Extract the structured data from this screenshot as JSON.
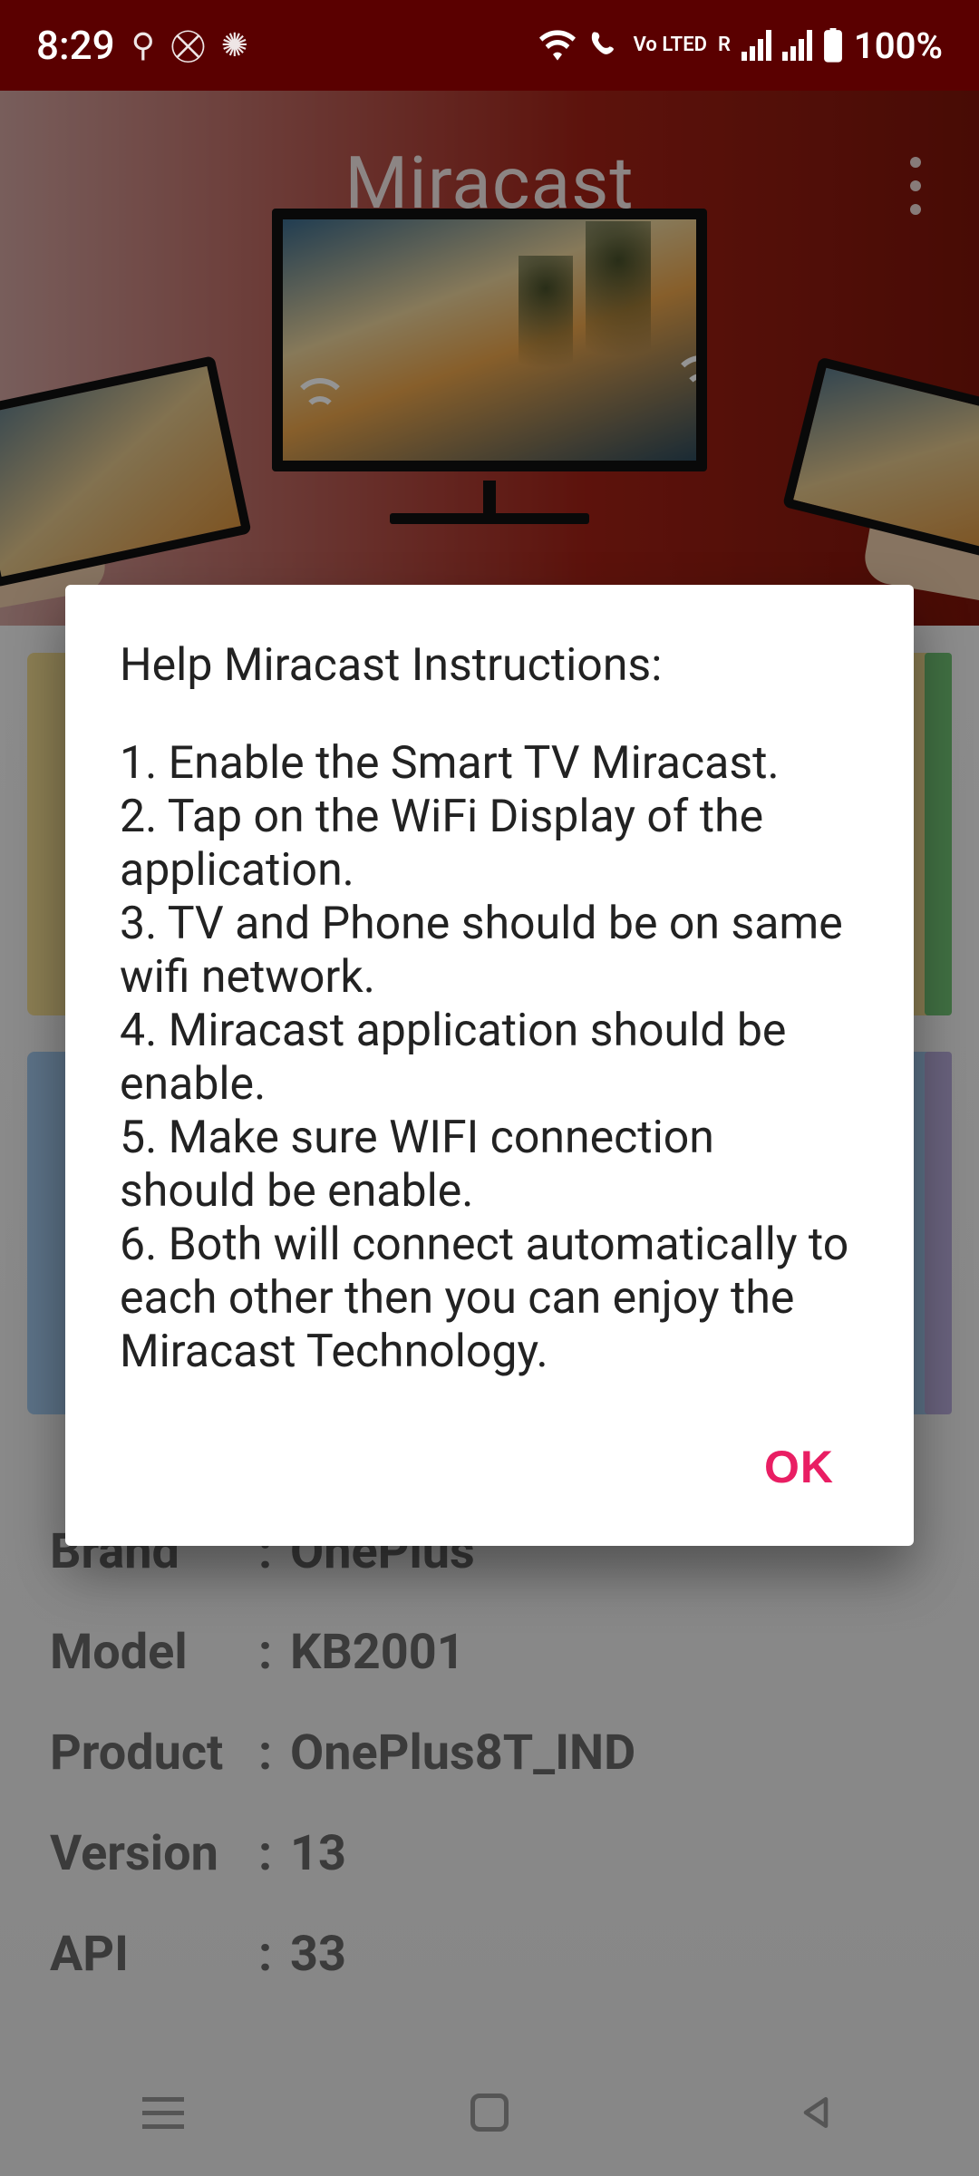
{
  "status_bar": {
    "time": "8:29",
    "battery_text": "100%",
    "network_badge": "Vo LTED",
    "roaming": "R"
  },
  "header": {
    "title": "Miracast"
  },
  "dialog": {
    "title": "Help Miracast Instructions:",
    "steps": [
      "1. Enable the Smart TV Miracast.",
      "2. Tap on the WiFi Display of the application.",
      "3. TV and Phone should be on same wifi network.",
      "4. Miracast application should be enable.",
      "5. Make sure WIFI connection should be enable.",
      "6. Both will connect automatically to each other then you can enjoy the Miracast Technology."
    ],
    "ok_label": "OK"
  },
  "device_info": {
    "brand_label": "Brand",
    "brand_value": "OnePlus",
    "model_label": "Model",
    "model_value": "KB2001",
    "product_label": "Product",
    "product_value": "OnePlus8T_IND",
    "version_label": "Version",
    "version_value": "13",
    "api_label": "API",
    "api_value": "33"
  }
}
